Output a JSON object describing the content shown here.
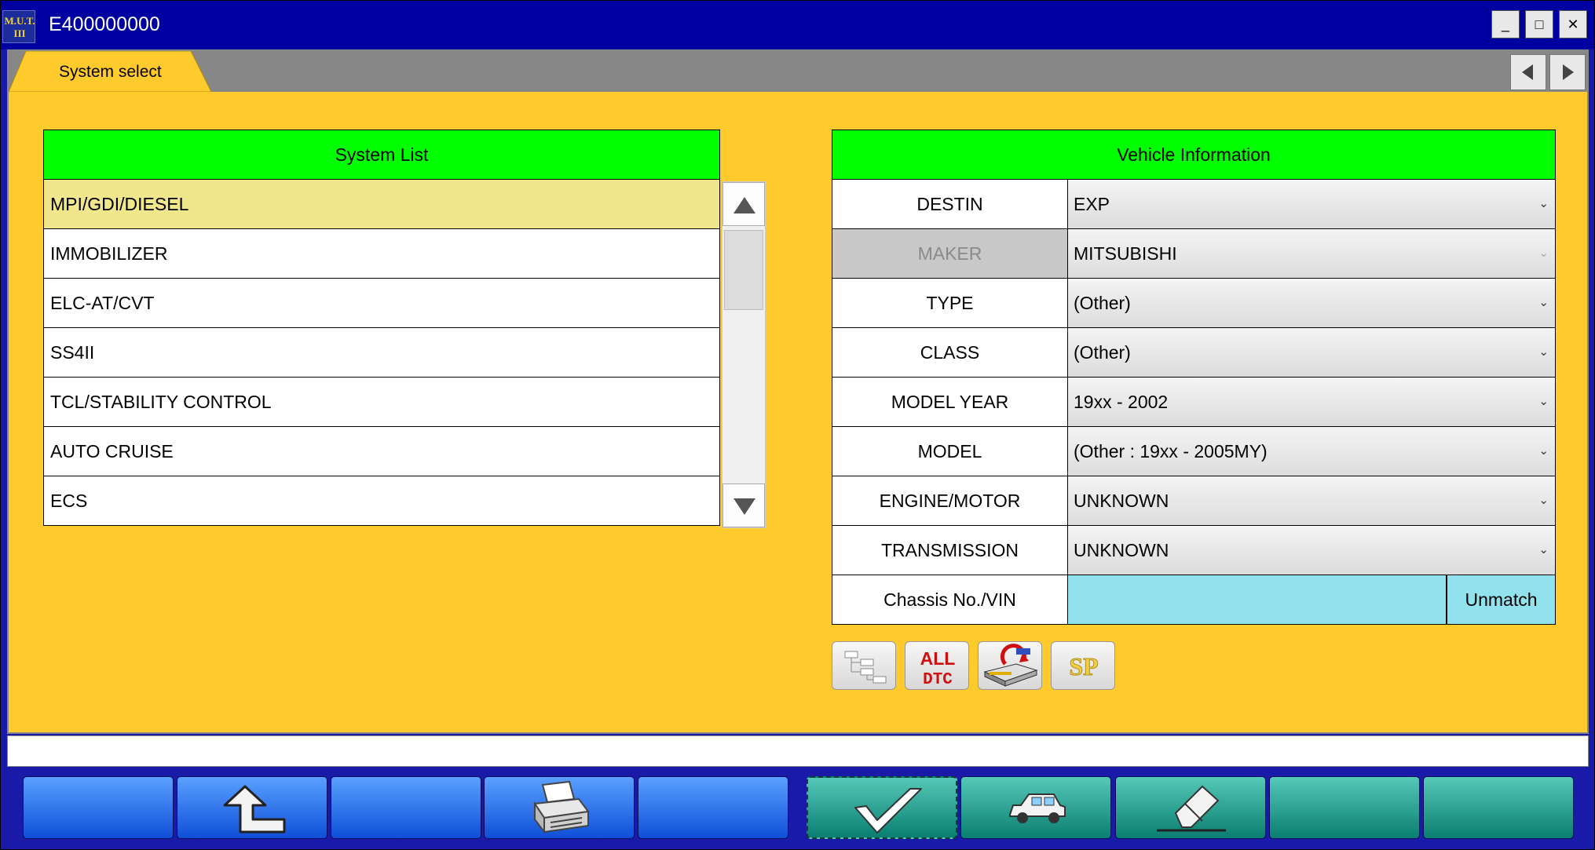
{
  "window": {
    "title": "E400000000",
    "app_icon_text": [
      "M.U.T.",
      "III"
    ],
    "minimize_glyph": "_",
    "maximize_glyph": "□",
    "close_glyph": "✕"
  },
  "tabs": [
    {
      "label": "System select",
      "active": true
    }
  ],
  "system_list": {
    "header": "System List",
    "selected_index": 0,
    "items": [
      "MPI/GDI/DIESEL",
      "IMMOBILIZER",
      "ELC-AT/CVT",
      "SS4II",
      "TCL/STABILITY CONTROL",
      "AUTO CRUISE",
      "ECS"
    ]
  },
  "vehicle_info": {
    "header": "Vehicle Information",
    "rows": [
      {
        "label": "DESTIN",
        "value": "EXP",
        "enabled": true
      },
      {
        "label": "MAKER",
        "value": "MITSUBISHI",
        "enabled": false
      },
      {
        "label": "TYPE",
        "value": "(Other)",
        "enabled": true
      },
      {
        "label": "CLASS",
        "value": "(Other)",
        "enabled": true
      },
      {
        "label": "MODEL YEAR",
        "value": "19xx - 2002",
        "enabled": true
      },
      {
        "label": "MODEL",
        "value": "(Other : 19xx - 2005MY)",
        "enabled": true
      },
      {
        "label": "ENGINE/MOTOR",
        "value": "UNKNOWN",
        "enabled": true
      },
      {
        "label": "TRANSMISSION",
        "value": "UNKNOWN",
        "enabled": true
      }
    ],
    "vin": {
      "label": "Chassis No./VIN",
      "value": "",
      "button_label": "Unmatch"
    }
  },
  "tool_buttons": [
    {
      "name": "system-tree-icon"
    },
    {
      "name": "all-dtc-icon",
      "text_top": "ALL",
      "text_bottom": "DTC"
    },
    {
      "name": "ecu-reprogram-icon"
    },
    {
      "name": "sp-icon",
      "text": "SP"
    }
  ],
  "status_text": "",
  "footer_buttons": [
    {
      "name": "blank-1",
      "color": "blue"
    },
    {
      "name": "back-arrow-icon",
      "color": "blue"
    },
    {
      "name": "blank-2",
      "color": "blue"
    },
    {
      "name": "printer-icon",
      "color": "blue"
    },
    {
      "name": "blank-3",
      "color": "blue"
    },
    {
      "name": "checkmark-icon",
      "color": "green"
    },
    {
      "name": "car-icon",
      "color": "green"
    },
    {
      "name": "eraser-icon",
      "color": "green"
    },
    {
      "name": "blank-4",
      "color": "green"
    },
    {
      "name": "blank-5",
      "color": "green"
    }
  ],
  "colors": {
    "title_bar": "#0000a0",
    "background": "#ffca2c",
    "header_green": "#00ff00",
    "selected_row": "#f0e68c",
    "vin_field": "#92e2ee",
    "tab_yellow": "#ffca2c"
  }
}
